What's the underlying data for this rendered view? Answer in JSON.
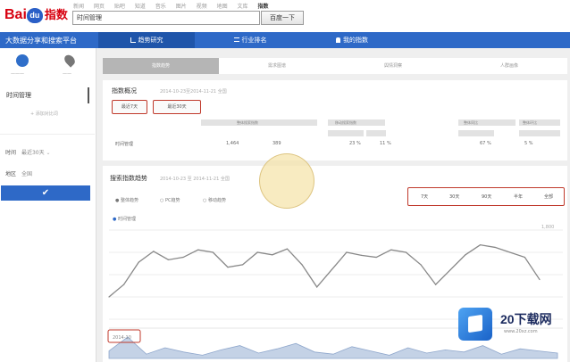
{
  "header": {
    "logo_text": "Bai",
    "logo_paw": "du",
    "logo_cn": "指数",
    "top_links": [
      "新闻",
      "网页",
      "贴吧",
      "知道",
      "音乐",
      "图片",
      "视频",
      "地图",
      "文库",
      "指数"
    ],
    "active_link_index": 9,
    "search_value": "时间管理",
    "search_button": "百度一下"
  },
  "navbar": {
    "brand": "大数据分享和搜索平台",
    "tabs": [
      "趋势研究",
      "行业排名",
      "我的指数"
    ],
    "active_tab_index": 0,
    "tab_icons": [
      "bar-chart-icon",
      "list-icon",
      "user-icon"
    ]
  },
  "sidebar": {
    "icon_labels": [
      "data-icon",
      "location-icon"
    ],
    "keyword": "时间管理",
    "add_keyword": "+ 添加对比词",
    "filter_time_label": "时间",
    "filter_time_value": "最近30天",
    "filter_region_label": "地区",
    "filter_region_value": "全国",
    "confirm_icon": "checkmark-icon"
  },
  "subtabs": [
    "指数趋势",
    "需求图谱",
    "舆情洞察",
    "人群画像"
  ],
  "subtabs_active_index": 0,
  "panel_overview": {
    "title": "指数概况",
    "note": "2014-10-23至2014-11-21 全国",
    "buttons": [
      "最近7天",
      "最近30天"
    ],
    "header_cells": [
      "整体搜索指数",
      "移动搜索指数",
      "整体同比",
      "整体环比",
      "移动同比",
      "移动环比"
    ],
    "row": {
      "keyword": "时间管理",
      "v1": "1,464",
      "v2": "389",
      "v3": "23 %",
      "v4": "11 %",
      "v5": "67 %",
      "v6": "5 %"
    }
  },
  "panel_trend": {
    "title": "搜索指数趋势",
    "note": "2014-10-23 至 2014-11-21 全国",
    "range_buttons": [
      "7天",
      "30天",
      "90天",
      "半年",
      "全部"
    ],
    "radios": [
      "整体趋势",
      "PC趋势",
      "移动趋势"
    ],
    "active_radio_index": 0,
    "legend": "时间管理",
    "y_max_label": "1,800",
    "timeline_label": "2014-10"
  },
  "chart_data": {
    "type": "line",
    "title": "",
    "xlabel": "",
    "ylabel": "",
    "ylim": [
      0,
      1800
    ],
    "series": [
      {
        "name": "时间管理",
        "values": [
          450,
          700,
          1150,
          1370,
          1200,
          1250,
          1400,
          1350,
          1050,
          1100,
          1350,
          1300,
          1420,
          1100,
          650,
          1000,
          1350,
          1290,
          1250,
          1400,
          1350,
          1100,
          700,
          1000,
          1300,
          1500,
          1450,
          1350,
          1250,
          800
        ]
      }
    ],
    "line_color": "#888888",
    "grid": true,
    "legend_position": "top-left"
  },
  "overview_chart": {
    "values": [
      7,
      20,
      4,
      10,
      6,
      3,
      8,
      12,
      5,
      9,
      14,
      6,
      4,
      11,
      7,
      3,
      10,
      5,
      8,
      6,
      12,
      4,
      9,
      7,
      5
    ]
  },
  "watermark": {
    "name": "20下载网",
    "url": "www.20xz.com"
  },
  "colors": {
    "brand_blue": "#2e69c7",
    "highlight_red": "#c0392b"
  }
}
